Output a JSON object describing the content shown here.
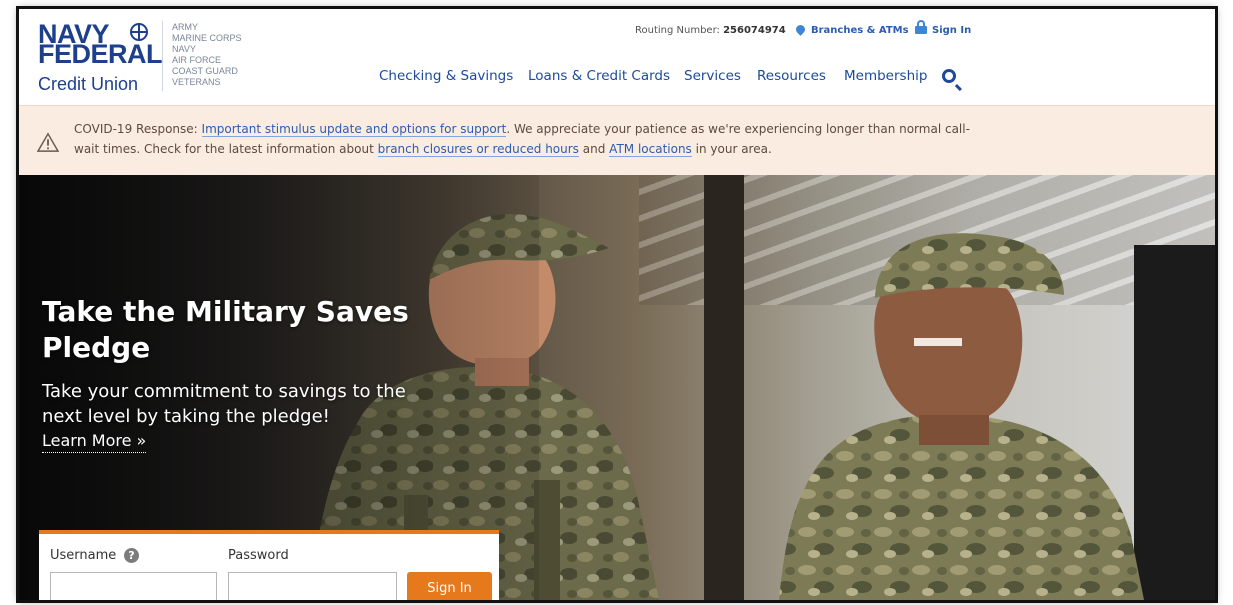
{
  "brand": {
    "line1": "NAVY",
    "line2": "FEDERAL",
    "line3": "Credit Union",
    "branches": [
      "ARMY",
      "MARINE CORPS",
      "NAVY",
      "AIR FORCE",
      "COAST GUARD",
      "VETERANS"
    ],
    "accent_color": "#1d3f8c"
  },
  "utility": {
    "routing_label": "Routing Number:",
    "routing_number": "256074974",
    "branches_label": "Branches & ATMs",
    "signin_label": "Sign In"
  },
  "nav": {
    "items": [
      "Checking & Savings",
      "Loans & Credit Cards",
      "Services",
      "Resources",
      "Membership"
    ]
  },
  "alert": {
    "prefix": "COVID-19 Response:",
    "stimulus_link": "Important stimulus update and options for support",
    "middle_text": ". We appreciate your patience as we're experiencing longer than normal call-wait times. Check for the latest information about",
    "branch_link": "branch closures or reduced hours",
    "and_text": "and",
    "atm_link": "ATM locations",
    "suffix": "in your area."
  },
  "hero": {
    "title": "Take the Military Saves Pledge",
    "subtitle": "Take your commitment to savings to the next level by taking the pledge!",
    "learn_more": "Learn More »"
  },
  "login": {
    "username_label": "Username",
    "username_value": "",
    "help_icon": "?",
    "password_label": "Password",
    "password_value": "",
    "signin_label": "Sign In",
    "button_color": "#e7791d"
  }
}
